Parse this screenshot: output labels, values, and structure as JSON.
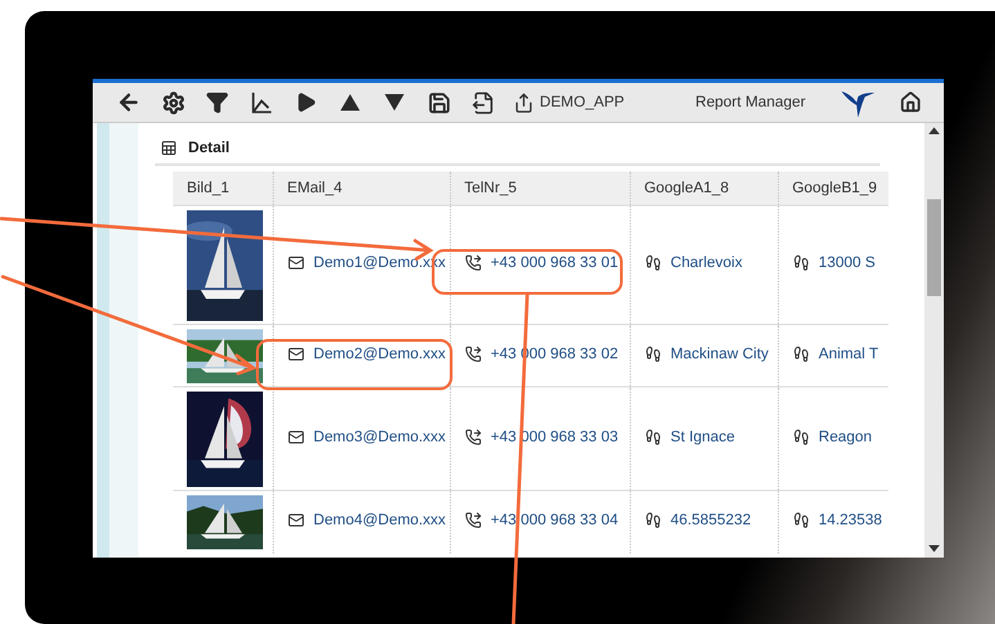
{
  "toolbar": {
    "app_button": "DEMO_APP",
    "title": "Report Manager"
  },
  "section": {
    "title": "Detail"
  },
  "table": {
    "columns": [
      "Bild_1",
      "EMail_4",
      "TelNr_5",
      "GoogleA1_8",
      "GoogleB1_9"
    ],
    "rows": [
      {
        "email": "Demo1@Demo.xxx",
        "phone": "+43 000 968 33 01",
        "google_a": "Charlevoix",
        "google_b": "13000 S"
      },
      {
        "email": "Demo2@Demo.xxx",
        "phone": "+43 000 968 33 02",
        "google_a": "Mackinaw City",
        "google_b": "Animal T"
      },
      {
        "email": "Demo3@Demo.xxx",
        "phone": "+43 000 968 33 03",
        "google_a": "St Ignace",
        "google_b": "Reagon"
      },
      {
        "email": "Demo4@Demo.xxx",
        "phone": "+43 000 968 33 04",
        "google_a": "46.5855232",
        "google_b": "14.23538"
      }
    ]
  }
}
